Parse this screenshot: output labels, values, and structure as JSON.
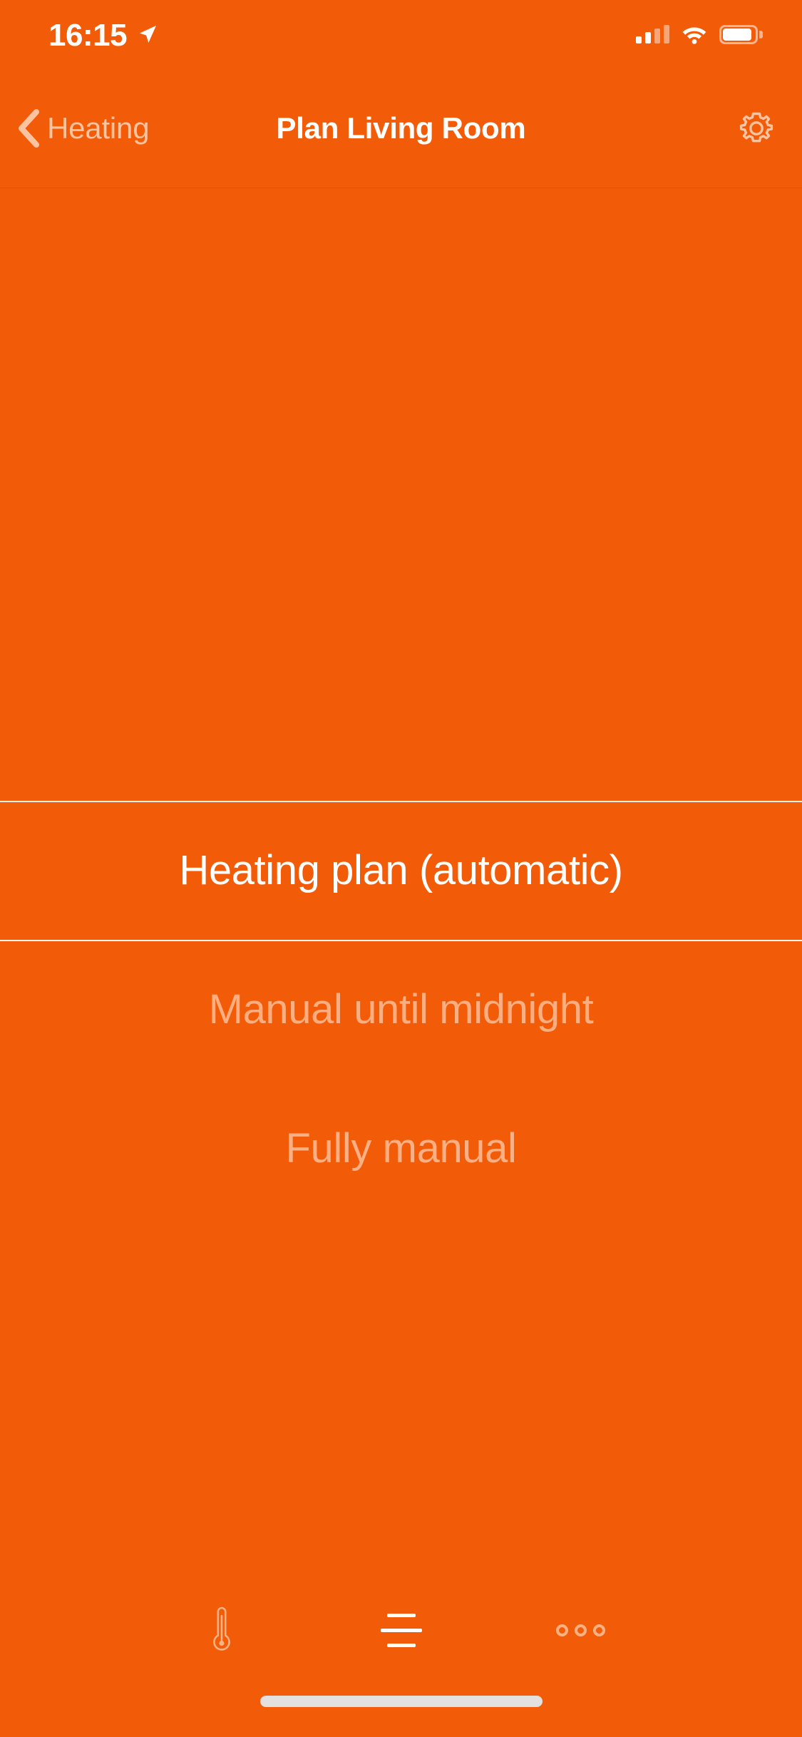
{
  "theme": {
    "background": "#F25C08",
    "accent_text": "#FFFFFF",
    "muted_text": "#FCAE81",
    "separator": "#FFFFFF"
  },
  "status_bar": {
    "time": "16:15",
    "location_icon": "location-arrow-icon",
    "signal_icon": "cellular-signal-icon",
    "signal_bars_filled": 2,
    "signal_bars_total": 4,
    "wifi_icon": "wifi-icon",
    "battery_icon": "battery-icon"
  },
  "nav_bar": {
    "back_icon": "chevron-left-icon",
    "back_label": "Heating",
    "title": "Plan Living Room",
    "settings_icon": "gear-icon"
  },
  "picker": {
    "selected_index": 0,
    "options": [
      {
        "label": "Heating plan (automatic)",
        "state": "selected"
      },
      {
        "label": "Manual until midnight",
        "state": "dim"
      },
      {
        "label": "Fully manual",
        "state": "dimmer"
      }
    ]
  },
  "toolbar": {
    "items": [
      {
        "icon": "thermometer-icon",
        "name": "tab-temperature",
        "active": false
      },
      {
        "icon": "horizontal-lines-icon",
        "name": "tab-plan",
        "active": true
      },
      {
        "icon": "three-dots-icon",
        "name": "tab-more",
        "active": false
      }
    ]
  },
  "home_indicator": {
    "icon": "home-indicator-bar"
  }
}
